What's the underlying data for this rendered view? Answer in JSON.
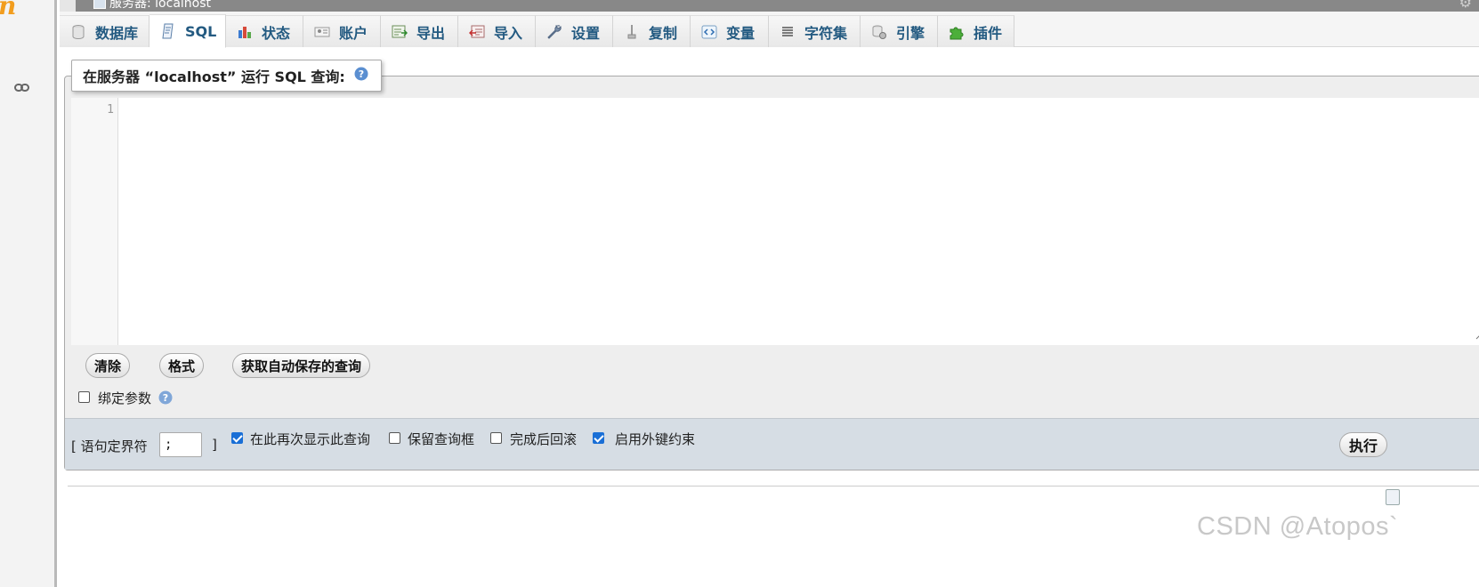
{
  "header": {
    "server_label": "服务器: localhost"
  },
  "tabs": [
    {
      "label": "数据库",
      "icon": "database-icon"
    },
    {
      "label": "SQL",
      "icon": "sql-icon",
      "active": true
    },
    {
      "label": "状态",
      "icon": "status-chart-icon"
    },
    {
      "label": "账户",
      "icon": "user-card-icon"
    },
    {
      "label": "导出",
      "icon": "export-icon"
    },
    {
      "label": "导入",
      "icon": "import-icon"
    },
    {
      "label": "设置",
      "icon": "wrench-icon"
    },
    {
      "label": "复制",
      "icon": "replication-icon"
    },
    {
      "label": "变量",
      "icon": "variables-icon"
    },
    {
      "label": "字符集",
      "icon": "charset-icon"
    },
    {
      "label": "引擎",
      "icon": "engine-icon"
    },
    {
      "label": "插件",
      "icon": "plugin-puzzle-icon"
    }
  ],
  "query": {
    "legend": "在服务器 “localhost” 运行 SQL 查询:",
    "line_number": "1",
    "editor_value": ""
  },
  "buttons": {
    "clear": "清除",
    "format": "格式",
    "autosaved": "获取自动保存的查询"
  },
  "bind_params": {
    "label": "绑定参数",
    "checked": false
  },
  "options": {
    "delimiter_open": "[ 语句定界符",
    "delimiter_value": ";",
    "delimiter_close": "]",
    "show_query_again": {
      "label": "在此再次显示此查询",
      "checked": true
    },
    "retain_query_box": {
      "label": "保留查询框",
      "checked": false
    },
    "rollback": {
      "label": "完成后回滚",
      "checked": false
    },
    "foreign_keys": {
      "label": "启用外键约束",
      "checked": true
    },
    "go": "执行"
  },
  "watermark": "CSDN @Atopos`",
  "colors": {
    "tab_text": "#235a81",
    "checkbox_checked": "#1a6fd6",
    "logo_orange": "#f29d1e",
    "bottom_bar": "#d6dde4"
  }
}
